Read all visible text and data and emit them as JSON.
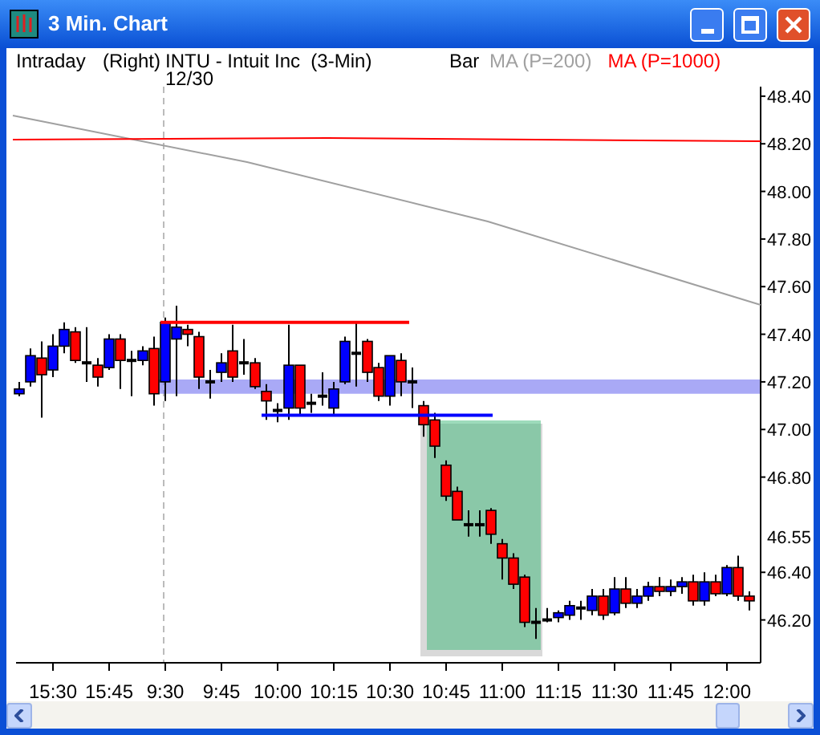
{
  "window": {
    "title": "3 Min. Chart"
  },
  "header": {
    "range": "Intraday",
    "axis_side": "(Right)",
    "symbol": "INTU - Intuit Inc  (3-Min)",
    "date": "12/30",
    "chart_style": "Bar",
    "indicators": [
      {
        "label": "MA (P=200)",
        "color": "#a0a0a0"
      },
      {
        "label": "MA (P=1000)",
        "color": "#ff0000"
      }
    ]
  },
  "chart_data": {
    "type": "candlestick",
    "categories": [
      null,
      null,
      null,
      "15:30",
      null,
      null,
      null,
      null,
      "15:45",
      null,
      null,
      null,
      null,
      "9:30",
      null,
      null,
      null,
      null,
      "9:45",
      null,
      null,
      null,
      null,
      "10:00",
      null,
      null,
      null,
      null,
      "10:15",
      null,
      null,
      null,
      null,
      "10:30",
      null,
      null,
      null,
      null,
      "10:45",
      null,
      null,
      null,
      null,
      "11:00",
      null,
      null,
      null,
      null,
      "11:15",
      null,
      null,
      null,
      null,
      "11:30",
      null,
      null,
      null,
      null,
      "11:45",
      null,
      null,
      null,
      null,
      "12:00",
      null,
      null
    ],
    "ylim": [
      46.02,
      48.44
    ],
    "ohlc": [
      [
        47.15,
        47.2,
        47.14,
        47.17
      ],
      [
        47.2,
        47.34,
        47.18,
        47.31
      ],
      [
        47.3,
        47.37,
        47.05,
        47.23
      ],
      [
        47.25,
        47.4,
        47.22,
        47.35
      ],
      [
        47.35,
        47.45,
        47.32,
        47.42
      ],
      [
        47.41,
        47.43,
        47.28,
        47.29
      ],
      [
        47.28,
        47.43,
        47.2,
        47.27
      ],
      [
        47.27,
        47.3,
        47.18,
        47.22
      ],
      [
        47.26,
        47.4,
        47.25,
        47.38
      ],
      [
        47.38,
        47.4,
        47.17,
        47.29
      ],
      [
        47.29,
        47.33,
        47.14,
        47.29
      ],
      [
        47.29,
        47.35,
        47.27,
        47.33
      ],
      [
        47.34,
        47.39,
        47.1,
        47.15
      ],
      [
        47.2,
        47.47,
        47.12,
        47.45
      ],
      [
        47.38,
        47.52,
        47.14,
        47.43
      ],
      [
        47.42,
        47.44,
        47.35,
        47.4
      ],
      [
        47.39,
        47.41,
        47.17,
        47.22
      ],
      [
        47.2,
        47.25,
        47.13,
        47.19
      ],
      [
        47.24,
        47.32,
        47.2,
        47.28
      ],
      [
        47.33,
        47.44,
        47.2,
        47.22
      ],
      [
        47.27,
        47.38,
        47.23,
        47.28
      ],
      [
        47.28,
        47.3,
        47.17,
        47.18
      ],
      [
        47.16,
        47.19,
        47.04,
        47.12
      ],
      [
        47.08,
        47.11,
        47.03,
        47.08
      ],
      [
        47.09,
        47.44,
        47.04,
        47.27
      ],
      [
        47.27,
        47.27,
        47.06,
        47.09
      ],
      [
        47.11,
        47.15,
        47.07,
        47.11
      ],
      [
        47.14,
        47.24,
        47.1,
        47.14
      ],
      [
        47.09,
        47.2,
        47.06,
        47.17
      ],
      [
        47.2,
        47.39,
        47.19,
        47.37
      ],
      [
        47.32,
        47.45,
        47.18,
        47.31
      ],
      [
        47.37,
        47.38,
        47.2,
        47.24
      ],
      [
        47.26,
        47.28,
        47.12,
        47.14
      ],
      [
        47.14,
        47.31,
        47.1,
        47.31
      ],
      [
        47.29,
        47.32,
        47.14,
        47.2
      ],
      [
        47.2,
        47.26,
        47.09,
        47.19
      ],
      [
        47.1,
        47.12,
        46.97,
        47.02
      ],
      [
        47.04,
        47.07,
        46.88,
        46.93
      ],
      [
        46.85,
        46.87,
        46.7,
        46.72
      ],
      [
        46.74,
        46.76,
        46.62,
        46.62
      ],
      [
        46.6,
        46.66,
        46.55,
        46.59
      ],
      [
        46.6,
        46.66,
        46.55,
        46.59
      ],
      [
        46.66,
        46.67,
        46.52,
        46.56
      ],
      [
        46.52,
        46.54,
        46.37,
        46.46
      ],
      [
        46.46,
        46.48,
        46.33,
        46.35
      ],
      [
        46.38,
        46.39,
        46.17,
        46.19
      ],
      [
        46.19,
        46.25,
        46.12,
        46.19
      ],
      [
        46.2,
        46.25,
        46.19,
        46.2
      ],
      [
        46.21,
        46.24,
        46.19,
        46.23
      ],
      [
        46.22,
        46.28,
        46.2,
        46.26
      ],
      [
        46.25,
        46.28,
        46.2,
        46.24
      ],
      [
        46.24,
        46.33,
        46.22,
        46.3
      ],
      [
        46.3,
        46.33,
        46.2,
        46.22
      ],
      [
        46.23,
        46.38,
        46.22,
        46.33
      ],
      [
        46.33,
        46.38,
        46.25,
        46.27
      ],
      [
        46.27,
        46.33,
        46.25,
        46.3
      ],
      [
        46.3,
        46.36,
        46.28,
        46.34
      ],
      [
        46.34,
        46.38,
        46.3,
        46.32
      ],
      [
        46.32,
        46.37,
        46.3,
        46.34
      ],
      [
        46.34,
        46.38,
        46.31,
        46.36
      ],
      [
        46.36,
        46.39,
        46.26,
        46.28
      ],
      [
        46.28,
        46.4,
        46.26,
        46.36
      ],
      [
        46.36,
        46.39,
        46.3,
        46.31
      ],
      [
        46.31,
        46.43,
        46.3,
        46.42
      ],
      [
        46.42,
        46.47,
        46.28,
        46.3
      ],
      [
        46.3,
        46.32,
        46.24,
        46.28
      ]
    ],
    "yticks": [
      {
        "value": 48.4,
        "label": "48.40"
      },
      {
        "value": 48.2,
        "label": "48.20"
      },
      {
        "value": 48.0,
        "label": "48.00"
      },
      {
        "value": 47.8,
        "label": "47.80"
      },
      {
        "value": 47.6,
        "label": "47.60"
      },
      {
        "value": 47.4,
        "label": "47.40"
      },
      {
        "value": 47.2,
        "label": "47.20"
      },
      {
        "value": 47.0,
        "label": "47.00"
      },
      {
        "value": 46.8,
        "label": "46.80"
      },
      {
        "value": 46.4,
        "label": "46.40"
      },
      {
        "value": 46.2,
        "label": "46.20"
      }
    ],
    "ref_lines": [
      {
        "axis": "y",
        "value": 47.45,
        "color": "#ff0000"
      },
      {
        "axis": "y",
        "value": 47.06,
        "color": "#0000ff"
      }
    ],
    "bands": [
      {
        "axis": "y",
        "from": 47.15,
        "to": 47.21,
        "color": "#7070f0"
      }
    ]
  },
  "price_marker": "46.55"
}
